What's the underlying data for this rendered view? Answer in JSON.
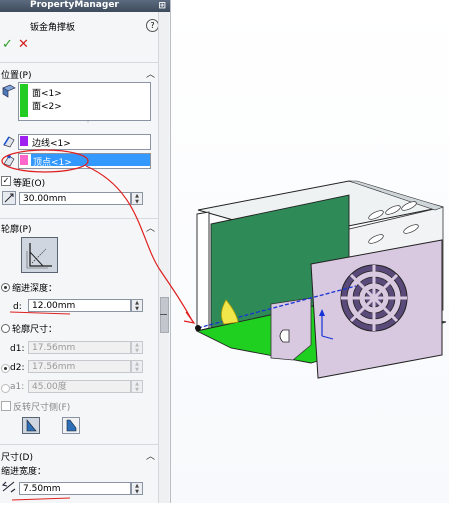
{
  "panel": {
    "title": "PropertyManager",
    "feature_title": "钣金角撑板",
    "help_label": "?",
    "ok_label": "✓",
    "cancel_label": "✕"
  },
  "position": {
    "title": "位置(P)",
    "faces": [
      "面<1>",
      "面<2>"
    ],
    "edge": "边线<1>",
    "vertex": "顶点<1>",
    "equal_spacing_label": "等距(O)",
    "equal_spacing_checked": true,
    "offset_value": "30.00mm"
  },
  "profile": {
    "title": "轮廓(P)",
    "indent_depth_label": "缩进深度：",
    "d_label": "d:",
    "d_value": "12.00mm",
    "profile_dims_label": "轮廓尺寸：",
    "d1_label": "d1:",
    "d1_value": "17.56mm",
    "d2_label": "d2:",
    "d2_value": "17.56mm",
    "a1_label": "a1:",
    "a1_value": "45.00度",
    "flip_label": "反转尺寸侧(F)"
  },
  "dimensions": {
    "title": "尺寸(D)",
    "indent_width_label": "缩进宽度：",
    "width_value": "7.50mm"
  },
  "colors": {
    "face_bar": "#22cc22",
    "edge_bar": "#a020f0",
    "vertex_bar": "#ff66cc",
    "selected_row": "#3399ff",
    "annotation": "#e02020",
    "model_green": "#2e8b57",
    "model_lavender": "#d8c8e0"
  }
}
